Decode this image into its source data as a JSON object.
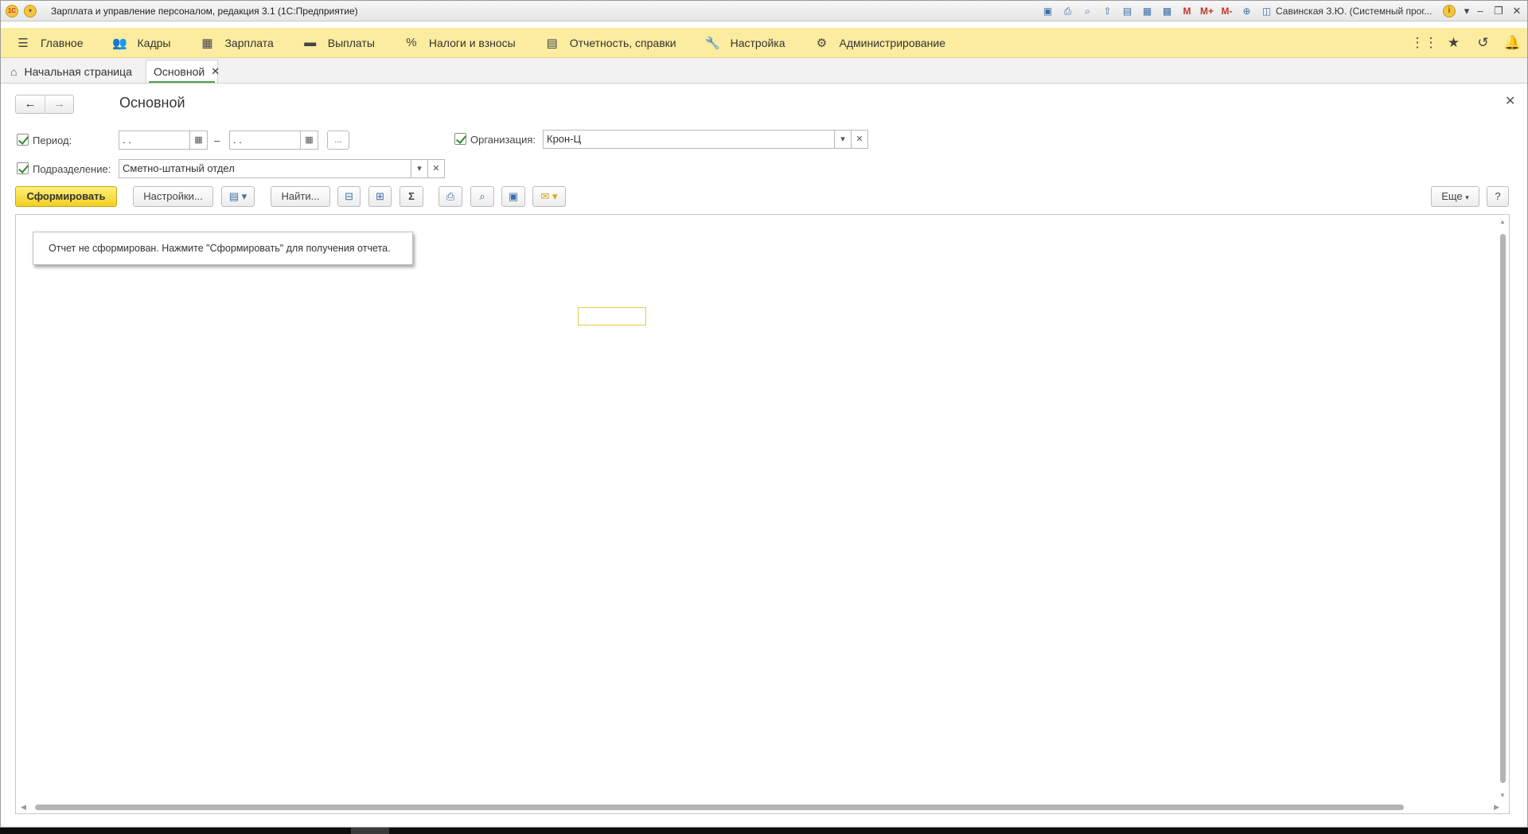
{
  "window": {
    "title": "Зарплата и управление персоналом, редакция 3.1  (1С:Предприятие)",
    "logo_text": "1С",
    "user": "Савинская З.Ю. (Системный прог...",
    "tools": [
      "save-icon",
      "print-icon",
      "preview-icon",
      "upload-icon",
      "doc-icon",
      "table-icon",
      "calendar-icon"
    ],
    "memory_buttons": [
      "M",
      "M+",
      "M-"
    ]
  },
  "mainmenu": {
    "items": [
      {
        "label": "Главное",
        "icon": "hamburger-icon"
      },
      {
        "label": "Кадры",
        "icon": "people-icon"
      },
      {
        "label": "Зарплата",
        "icon": "calculator-icon"
      },
      {
        "label": "Выплаты",
        "icon": "wallet-icon"
      },
      {
        "label": "Налоги и взносы",
        "icon": "percent-icon"
      },
      {
        "label": "Отчетность, справки",
        "icon": "reports-icon"
      },
      {
        "label": "Настройка",
        "icon": "wrench-icon"
      },
      {
        "label": "Администрирование",
        "icon": "gear-icon"
      }
    ]
  },
  "tabs": {
    "home": "Начальная страница",
    "active": "Основной"
  },
  "form": {
    "title": "Основной",
    "period_label": "Период:",
    "period_from": " .  .",
    "period_to": " .  .",
    "period_dash": "–",
    "period_more": "...",
    "org_label": "Организация:",
    "org_value": "Крон-Ц",
    "dept_label": "Подразделение:",
    "dept_value": "Сметно-штатный отдел"
  },
  "commandbar": {
    "generate": "Сформировать",
    "settings": "Настройки...",
    "find": "Найти...",
    "more": "Еще",
    "help": "?"
  },
  "report": {
    "notice": "Отчет не сформирован. Нажмите \"Сформировать\" для получения отчета."
  }
}
